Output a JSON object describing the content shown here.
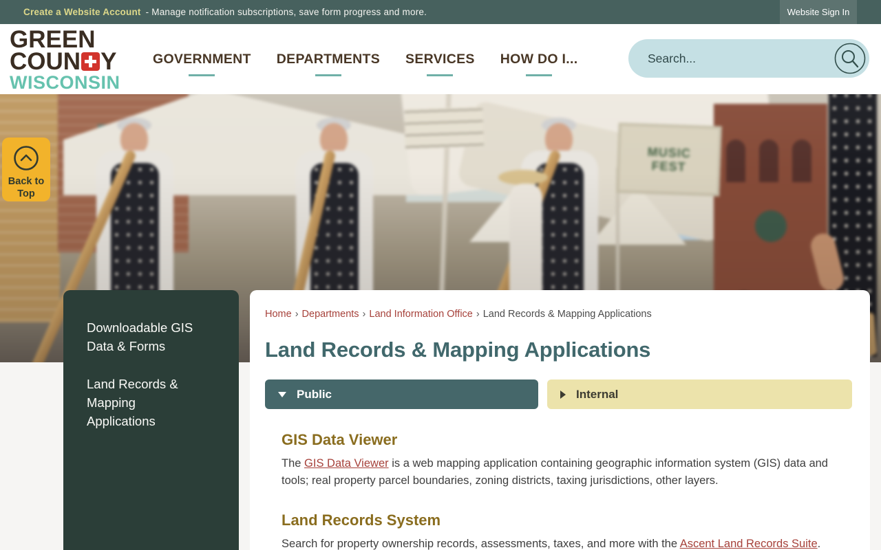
{
  "topbar": {
    "account_link": "Create a Website Account",
    "account_tagline": "- Manage notification subscriptions, save form progress and more.",
    "sign_in_label": "Website Sign In"
  },
  "header": {
    "logo": {
      "line1": "GREEN",
      "line2_left": "COUN",
      "line2_right": "Y",
      "line3": "WISCONSIN"
    },
    "nav": [
      {
        "label": "GOVERNMENT"
      },
      {
        "label": "DEPARTMENTS"
      },
      {
        "label": "SERVICES"
      },
      {
        "label": "HOW DO I..."
      }
    ],
    "search": {
      "placeholder": "Search..."
    }
  },
  "hero": {
    "sign_text": "MUSIC FEST"
  },
  "back_to_top": {
    "label": "Back to Top"
  },
  "sidebar": {
    "items": [
      {
        "label": "Downloadable GIS Data & Forms"
      },
      {
        "label": "Land Records & Mapping Applications"
      }
    ]
  },
  "main": {
    "breadcrumb": {
      "separator": "›",
      "items": [
        {
          "label": "Home"
        },
        {
          "label": "Departments"
        },
        {
          "label": "Land Information Office"
        },
        {
          "label": "Land Records & Mapping Applications"
        }
      ]
    },
    "title": "Land Records & Mapping Applications",
    "tabs": [
      {
        "label": "Public",
        "state": "expanded"
      },
      {
        "label": "Internal",
        "state": "collapsed"
      }
    ],
    "sections": [
      {
        "heading": "GIS Data Viewer",
        "text_before": "The ",
        "link_text": "GIS Data Viewer",
        "text_after": " is a web mapping application containing geographic information system (GIS) data and tools; real property parcel boundaries, zoning districts, taxing jurisdictions, other layers."
      },
      {
        "heading": "Land Records System",
        "text_before": "Search for property ownership records, assessments, taxes, and more with the ",
        "link_text": "Ascent Land Records Suite",
        "text_after": "."
      }
    ]
  },
  "colors": {
    "topbar_bg": "#47615e",
    "signin_bg": "#5d7370",
    "brand_brown": "#3a2d22",
    "brand_teal": "#66c2ae",
    "logo_cross_red": "#d2342c",
    "nav_underline": "#6fb0a8",
    "search_bg": "#c5e0e4",
    "back_to_top_bg": "#f2b32b",
    "sidebar_bg": "#2b3e38",
    "page_title_teal": "#41686c",
    "tab_public_bg": "#45676a",
    "tab_internal_bg": "#ece3ab",
    "section_heading_gold": "#8a6d1f",
    "link_red": "#a6413a"
  }
}
